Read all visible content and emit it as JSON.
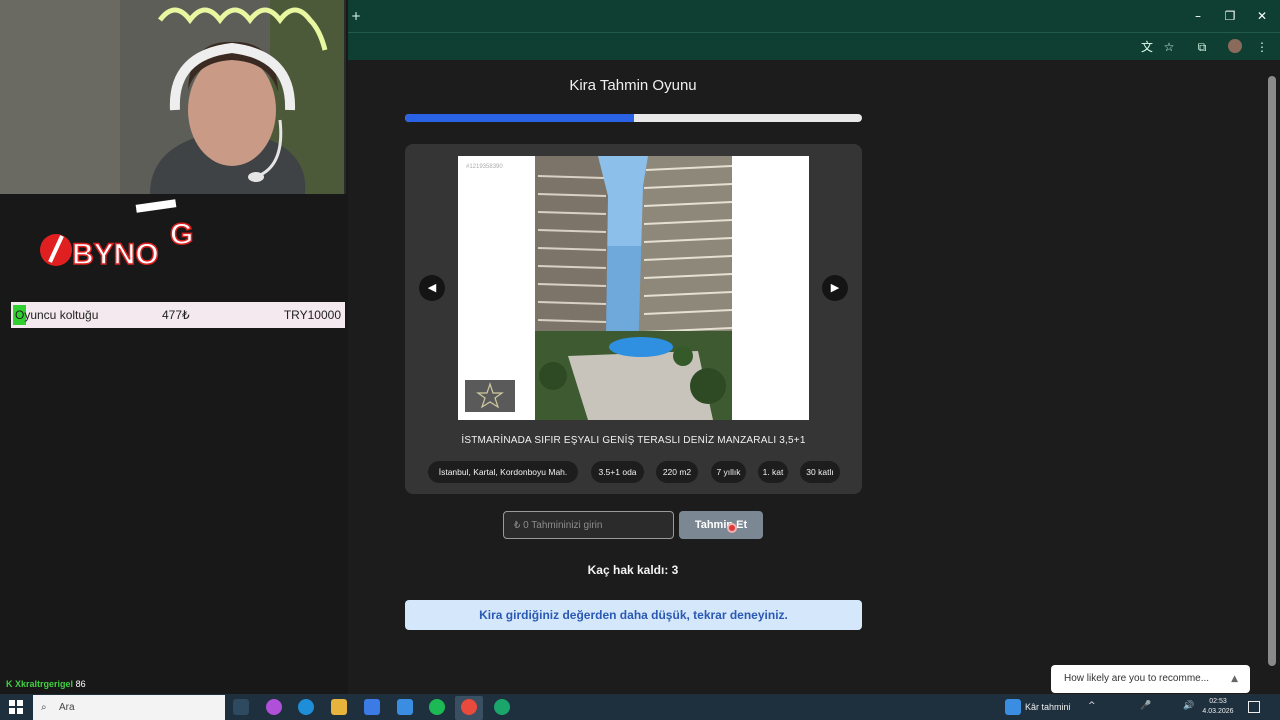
{
  "stream": {
    "logo_text": "BYNO",
    "logo_tail": "G",
    "seat": {
      "label": "Oyuncu koltuğu",
      "price": "477₺",
      "amount": "TRY10000"
    },
    "chat": {
      "user": "Xkraltrgerigel",
      "value": "86"
    }
  },
  "game": {
    "title": "Kira Tahmin Oyunu",
    "progress_fraction": 0.5,
    "photo_id": "#1219358390",
    "arrow_prev": "◀",
    "arrow_next": "▶",
    "listing_title": "İSTMARİNADA SIFIR EŞYALI GENİŞ TERASLI DENİZ MANZARALI 3,5+1",
    "tags": [
      "İstanbul, Kartal, Kordonboyu Mah.",
      "3.5+1 oda",
      "220 m2",
      "7 yıllık",
      "1. kat",
      "30 katlı"
    ],
    "input_placeholder": "₺ 0 Tahmininizi girin",
    "button_label": "Tahmin Et",
    "attempts_text": "Kaç hak kaldı: 3",
    "feedback_text": "Kira girdiğiniz değerden daha düşük, tekrar deneyiniz."
  },
  "survey": {
    "text": "How likely are you to recomme...",
    "caret": "▲"
  },
  "taskbar": {
    "search_placeholder": "Ara",
    "tray_label": "Kâr tahmini",
    "time": "02:53",
    "date": "4.03.2026"
  },
  "colors": {
    "progress": "#2a62e6",
    "feedback_bg": "#d5e8fb",
    "feedback_text": "#2b59b3",
    "chrome": "#0f3f33"
  }
}
